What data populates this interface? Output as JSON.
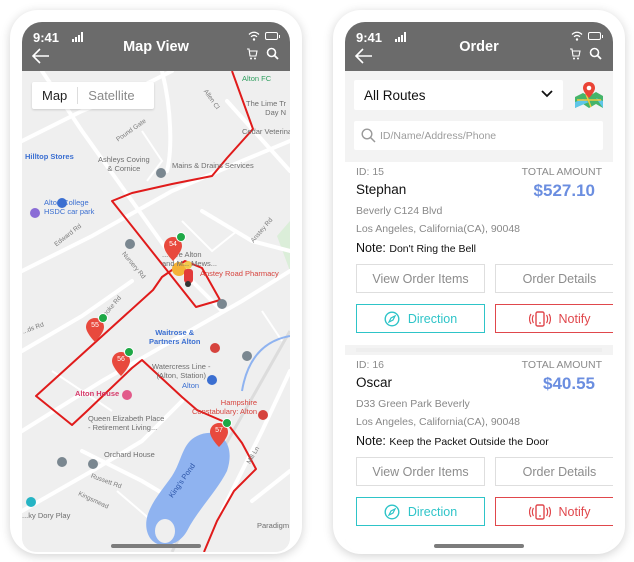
{
  "status_bar": {
    "time": "9:41"
  },
  "map_view": {
    "title": "Map View",
    "map_type_toggle": {
      "options": [
        "Map",
        "Satellite"
      ],
      "selected": "Map"
    },
    "places": [
      {
        "name": "Alton FC",
        "style": "gray"
      },
      {
        "name": "The Lime Tr\nDay N",
        "style": "gray"
      },
      {
        "name": "Allen Cl",
        "style": "road"
      },
      {
        "name": "Pound Gate",
        "style": "road"
      },
      {
        "name": "Cedar Veterina",
        "style": "gray"
      },
      {
        "name": "Hilltop Stores",
        "style": "blue"
      },
      {
        "name": "Ashleys Coving\n& Cornice",
        "style": "gray"
      },
      {
        "name": "Mains & Drains Services",
        "style": "gray"
      },
      {
        "name": "Alton College\nHSDC car park",
        "style": "blue"
      },
      {
        "name": "Edward Rd",
        "style": "road"
      },
      {
        "name": "Anstey Rd",
        "style": "road"
      },
      {
        "name": "Nursery Rd",
        "style": "road"
      },
      {
        "name": "Eastbrooke Rd",
        "style": "road"
      },
      {
        "name": "...care Alton\nand M... Mews...",
        "style": "gray"
      },
      {
        "name": "Anstey Road Pharmacy",
        "style": "red"
      },
      {
        "name": "Waitrose &\nPartners Alton",
        "style": "blue"
      },
      {
        "name": "Watercress Line -\n(Alton, Station)",
        "style": "gray"
      },
      {
        "name": "Alton",
        "style": "blue"
      },
      {
        "name": "Alton House",
        "style": "pink"
      },
      {
        "name": "Hampshire\nConstabulary: Alton",
        "style": "red"
      },
      {
        "name": "Queen Elizabeth Place\n- Retirement Living...",
        "style": "gray"
      },
      {
        "name": "Orchard House",
        "style": "gray"
      },
      {
        "name": "Russett Rd",
        "style": "road"
      },
      {
        "name": "Kingsmead",
        "style": "road"
      },
      {
        "name": "King's Pond",
        "style": "blue"
      },
      {
        "name": "Mill Ln",
        "style": "road"
      },
      {
        "name": "...ky Dory Play",
        "style": "gray"
      },
      {
        "name": "Paradigm",
        "style": "gray"
      },
      {
        "name": "...ds Rd",
        "style": "road"
      }
    ],
    "stops": [
      {
        "number": "54",
        "completed": true
      },
      {
        "number": "55",
        "completed": true
      },
      {
        "number": "56",
        "completed": true
      },
      {
        "number": "57",
        "completed": true
      }
    ],
    "route_color": "#e01b1b"
  },
  "order_view": {
    "title": "Order",
    "route_filter": {
      "selected": "All Routes"
    },
    "search": {
      "placeholder": "ID/Name/Address/Phone",
      "value": ""
    },
    "labels": {
      "total_amount": "TOTAL AMOUNT",
      "note": "Note:",
      "view_items": "View Order Items",
      "order_details": "Order Details",
      "direction": "Direction",
      "notify": "Notify"
    },
    "orders": [
      {
        "id": "ID: 15",
        "name": "Stephan",
        "amount": "$527.10",
        "address_line1": "Beverly C124 Blvd",
        "address_line2": "Los Angeles, California(CA), 90048",
        "note": "Don't Ring the Bell"
      },
      {
        "id": "ID: 16",
        "name": "Oscar",
        "amount": "$40.55",
        "address_line1": "D33 Green Park Beverly",
        "address_line2": "Los Angeles, California(CA), 90048",
        "note": "Keep the Packet Outside the Door"
      }
    ]
  },
  "colors": {
    "header": "#6b6b6b",
    "amount": "#6b8ee0",
    "direction": "#2ec4c8",
    "notify": "#e0474c",
    "completed": "#1ea846"
  }
}
